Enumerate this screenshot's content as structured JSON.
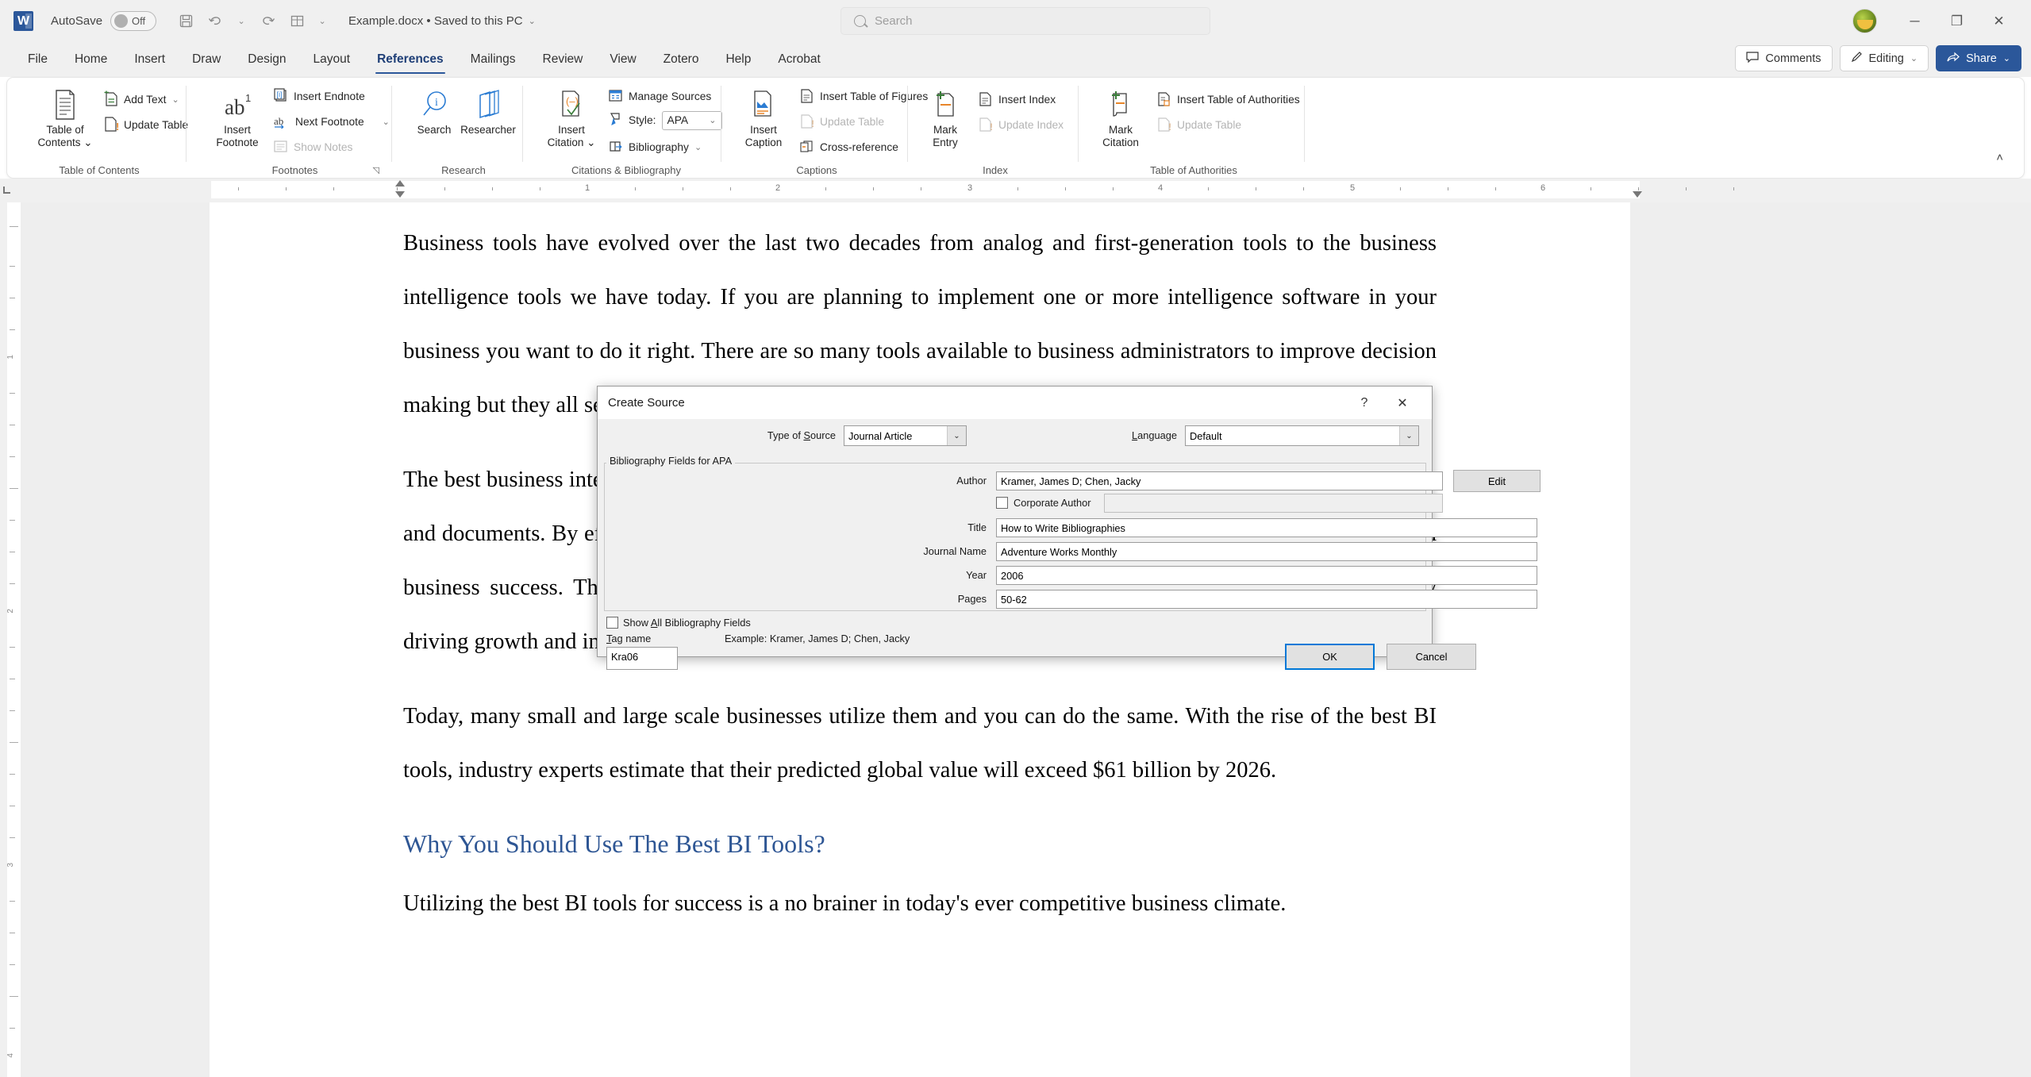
{
  "titlebar": {
    "app_icon": "word-logo",
    "autosave_label": "AutoSave",
    "autosave_state": "Off",
    "quick_access": [
      {
        "name": "save-icon",
        "glyph": "💾"
      },
      {
        "name": "undo-icon",
        "glyph": "↶"
      },
      {
        "name": "undo-dropdown-icon",
        "glyph": "⌄"
      },
      {
        "name": "redo-icon",
        "glyph": "↷"
      },
      {
        "name": "table-icon",
        "glyph": "▦"
      },
      {
        "name": "customize-qat-icon",
        "glyph": "⌄"
      }
    ],
    "document_name": "Example.docx • Saved to this PC",
    "search_placeholder": "Search",
    "window_minimize": "─",
    "window_restore": "❐",
    "window_close": "✕"
  },
  "tabs": [
    {
      "label": "File",
      "active": false
    },
    {
      "label": "Home",
      "active": false
    },
    {
      "label": "Insert",
      "active": false
    },
    {
      "label": "Draw",
      "active": false
    },
    {
      "label": "Design",
      "active": false
    },
    {
      "label": "Layout",
      "active": false
    },
    {
      "label": "References",
      "active": true
    },
    {
      "label": "Mailings",
      "active": false
    },
    {
      "label": "Review",
      "active": false
    },
    {
      "label": "View",
      "active": false
    },
    {
      "label": "Zotero",
      "active": false
    },
    {
      "label": "Help",
      "active": false
    },
    {
      "label": "Acrobat",
      "active": false
    }
  ],
  "right_tools": {
    "comments": "Comments",
    "editing": "Editing",
    "share": "Share"
  },
  "ribbon": {
    "groups": [
      {
        "name": "table-of-contents",
        "label": "Table of Contents",
        "big_button": "Table of\nContents",
        "big_button_line1": "Table of",
        "big_button_line2": "Contents",
        "items": [
          {
            "label": "Add Text",
            "disabled": false,
            "has_caret": true
          },
          {
            "label": "Update Table",
            "disabled": false,
            "has_caret": false
          }
        ]
      },
      {
        "name": "footnotes",
        "label": "Footnotes",
        "big_button_line1": "Insert",
        "big_button_line2": "Footnote",
        "items": [
          {
            "label": "Insert Endnote",
            "disabled": false,
            "has_caret": false
          },
          {
            "label": "Next Footnote",
            "disabled": false,
            "has_caret": true
          },
          {
            "label": "Show Notes",
            "disabled": true,
            "has_caret": false
          }
        ]
      },
      {
        "name": "research",
        "label": "Research",
        "buttons": [
          {
            "label": "Search"
          },
          {
            "label": "Researcher"
          }
        ]
      },
      {
        "name": "citations-bibliography",
        "label": "Citations & Bibliography",
        "big_button_line1": "Insert",
        "big_button_line2": "Citation",
        "items": [
          {
            "label": "Manage Sources",
            "disabled": false
          },
          {
            "label": "Style:",
            "disabled": false,
            "value": "APA"
          },
          {
            "label": "Bibliography",
            "disabled": false,
            "has_caret": true
          }
        ]
      },
      {
        "name": "captions",
        "label": "Captions",
        "big_button_line1": "Insert",
        "big_button_line2": "Caption",
        "items": [
          {
            "label": "Insert Table of Figures",
            "disabled": false
          },
          {
            "label": "Update Table",
            "disabled": true
          },
          {
            "label": "Cross-reference",
            "disabled": false
          }
        ]
      },
      {
        "name": "index",
        "label": "Index",
        "big_button_line1": "Mark",
        "big_button_line2": "Entry",
        "items": [
          {
            "label": "Insert Index",
            "disabled": false
          },
          {
            "label": "Update Index",
            "disabled": true
          }
        ]
      },
      {
        "name": "table-of-authorities",
        "label": "Table of Authorities",
        "big_button_line1": "Mark",
        "big_button_line2": "Citation",
        "items": [
          {
            "label": "Insert Table of Authorities",
            "disabled": false
          },
          {
            "label": "Update Table",
            "disabled": true
          }
        ]
      }
    ],
    "collapse_icon": "˄"
  },
  "ruler": {
    "horizontal_numbers": [
      "1",
      "2",
      "3",
      "4",
      "5",
      "6"
    ],
    "vertical_numbers": [
      "1",
      "2",
      "3",
      "4"
    ]
  },
  "document": {
    "paragraphs": [
      "Business tools have evolved over the last two decades from analog and first-generation tools to the business intelligence tools we have today.  If you are planning to implement one or more intelligence software in your business you want to do it right. There are so many tools available to business administrators to improve decision making but they all serve different purposes and command different price points.",
      "The best business intelligence tools are capable of presenting trends and insights from a given set of business data and documents. By effectively exposing and transforming data, these tools become key instruments for long-term business success. They empower organizations to analyze performance and identify opportunities, ultimately driving growth and innovation.",
      "Today, many small and large scale businesses utilize them and you can do the same. With the rise of the best BI tools, industry experts estimate that their predicted global value will exceed $61 billion by 2026."
    ],
    "heading": "Why You Should Use The Best BI Tools?",
    "paragraph_after_heading": "Utilizing the best BI tools for success is a no brainer in today's ever competitive business climate."
  },
  "dialog": {
    "title": "Create Source",
    "help_glyph": "?",
    "close_glyph": "✕",
    "type_of_source_label": "Type of Source",
    "type_of_source_value": "Journal Article",
    "language_label": "Language",
    "language_value": "Default",
    "group_title": "Bibliography Fields for APA",
    "fields": [
      {
        "label": "Author",
        "value": "Kramer, James D; Chen, Jacky"
      },
      {
        "label": "Title",
        "value": "How to Write Bibliographies"
      },
      {
        "label": "Journal Name",
        "value": "Adventure Works Monthly"
      },
      {
        "label": "Year",
        "value": "2006"
      },
      {
        "label": "Pages",
        "value": "50-62"
      }
    ],
    "edit_button": "Edit",
    "corporate_author_label": "Corporate Author",
    "corporate_author_value": "",
    "show_all_label": "Show All Bibliography Fields",
    "tag_name_label": "Tag name",
    "tag_name_value": "Kra06",
    "example_text": "Example: Kramer, James D; Chen, Jacky",
    "ok_button": "OK",
    "cancel_button": "Cancel"
  },
  "colors": {
    "accent": "#2b579a",
    "heading": "#2e5694",
    "ribbon_bg": "#ffffff",
    "chrome_bg": "#f0f0f0",
    "focus_blue": "#0078d7"
  }
}
